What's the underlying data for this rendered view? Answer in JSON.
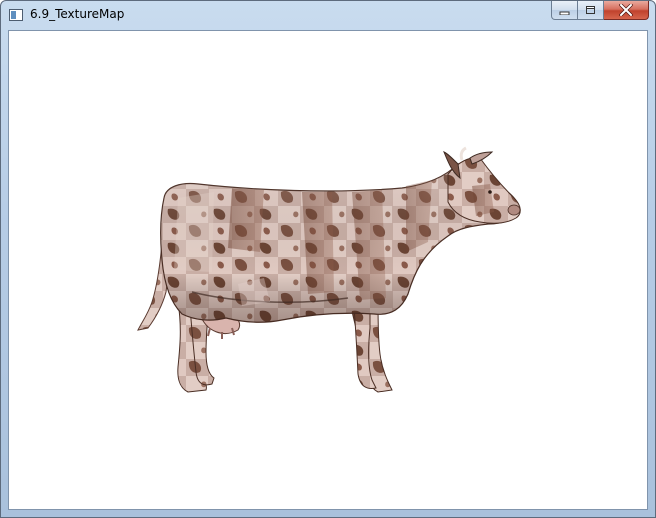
{
  "window": {
    "title": "6.9_TextureMap"
  },
  "icons": {
    "app": "application-window-icon",
    "minimize": "minimize-icon",
    "maximize": "maximize-icon",
    "close": "close-icon"
  },
  "colors": {
    "client_background": "#ffffff",
    "frame": "#b7cde6",
    "close_button": "#c0422d"
  }
}
